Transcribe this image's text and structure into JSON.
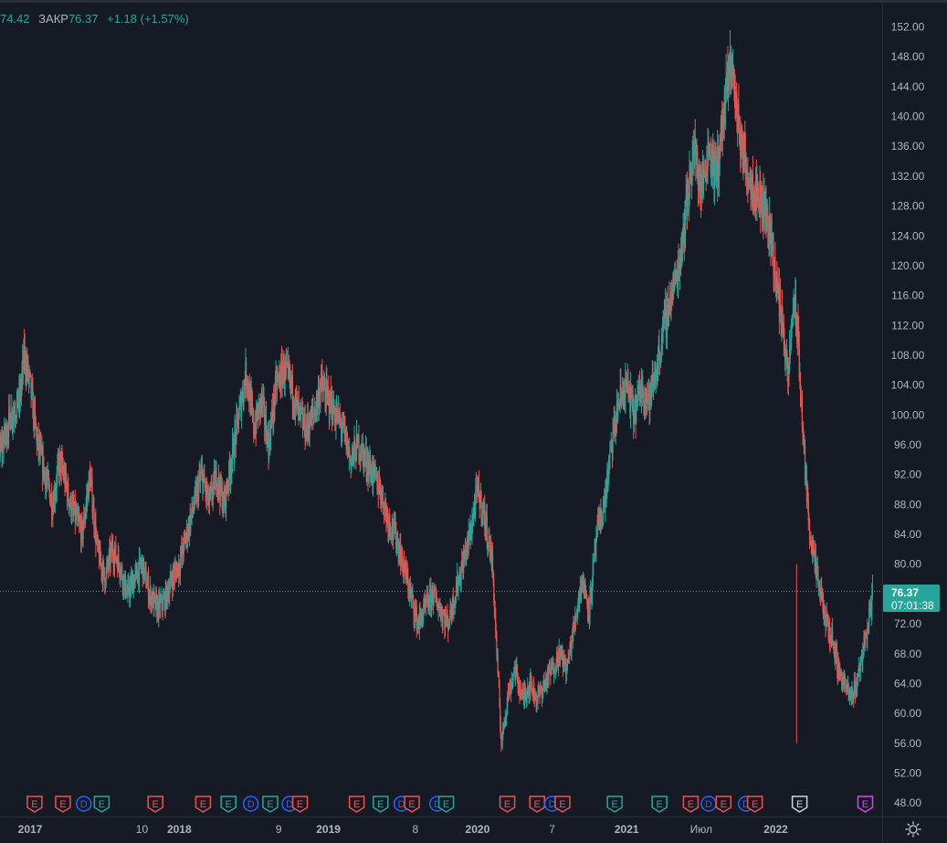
{
  "legend": {
    "prev_value": "74.42",
    "close_label": "ЗАКР",
    "close_value": "76.37",
    "change": "+1.18 (+1.57%)"
  },
  "price_badge": {
    "price": "76.37",
    "countdown": "07:01:38"
  },
  "colors": {
    "background": "#161a25",
    "up": "#26a69a",
    "down": "#ef5350",
    "axis_text": "#b2b5be",
    "axis_line": "#2a2e39"
  },
  "chart_data": {
    "type": "candlestick",
    "y_ticks": [
      "48.00",
      "52.00",
      "56.00",
      "60.00",
      "64.00",
      "68.00",
      "72.00",
      "80.00",
      "84.00",
      "88.00",
      "92.00",
      "96.00",
      "100.00",
      "104.00",
      "108.00",
      "112.00",
      "116.00",
      "120.00",
      "124.00",
      "128.00",
      "132.00",
      "136.00",
      "140.00",
      "144.00",
      "148.00",
      "152.00"
    ],
    "x_ticks": [
      {
        "label": "2017",
        "bold": true,
        "t": 2017.0
      },
      {
        "label": "10",
        "bold": false,
        "t": 2017.75
      },
      {
        "label": "2018",
        "bold": true,
        "t": 2018.0
      },
      {
        "label": "9",
        "bold": false,
        "t": 2018.667
      },
      {
        "label": "2019",
        "bold": true,
        "t": 2019.0
      },
      {
        "label": "8",
        "bold": false,
        "t": 2019.583
      },
      {
        "label": "2020",
        "bold": true,
        "t": 2020.0
      },
      {
        "label": "7",
        "bold": false,
        "t": 2020.5
      },
      {
        "label": "2021",
        "bold": true,
        "t": 2021.0
      },
      {
        "label": "Июл",
        "bold": false,
        "t": 2021.5
      },
      {
        "label": "2022",
        "bold": true,
        "t": 2022.0
      }
    ],
    "ylim": [
      48,
      152
    ],
    "last_price": 76.37,
    "price_path": [
      [
        2016.6,
        85
      ],
      [
        2016.65,
        80
      ],
      [
        2016.72,
        92
      ],
      [
        2016.8,
        95
      ],
      [
        2016.87,
        100
      ],
      [
        2016.93,
        102
      ],
      [
        2016.96,
        108
      ],
      [
        2017.0,
        104
      ],
      [
        2017.05,
        96
      ],
      [
        2017.1,
        92
      ],
      [
        2017.15,
        88
      ],
      [
        2017.2,
        94
      ],
      [
        2017.27,
        88
      ],
      [
        2017.35,
        84
      ],
      [
        2017.4,
        92
      ],
      [
        2017.45,
        82
      ],
      [
        2017.5,
        78
      ],
      [
        2017.55,
        82
      ],
      [
        2017.6,
        80
      ],
      [
        2017.65,
        76
      ],
      [
        2017.7,
        78
      ],
      [
        2017.75,
        80
      ],
      [
        2017.8,
        76
      ],
      [
        2017.85,
        74
      ],
      [
        2017.9,
        75
      ],
      [
        2017.95,
        78
      ],
      [
        2018.0,
        80
      ],
      [
        2018.05,
        84
      ],
      [
        2018.1,
        88
      ],
      [
        2018.15,
        92
      ],
      [
        2018.2,
        88
      ],
      [
        2018.25,
        92
      ],
      [
        2018.3,
        88
      ],
      [
        2018.35,
        94
      ],
      [
        2018.4,
        100
      ],
      [
        2018.45,
        106
      ],
      [
        2018.5,
        98
      ],
      [
        2018.55,
        102
      ],
      [
        2018.6,
        96
      ],
      [
        2018.65,
        104
      ],
      [
        2018.7,
        106
      ],
      [
        2018.75,
        104
      ],
      [
        2018.8,
        100
      ],
      [
        2018.85,
        98
      ],
      [
        2018.9,
        100
      ],
      [
        2018.95,
        104
      ],
      [
        2019.0,
        102
      ],
      [
        2019.05,
        100
      ],
      [
        2019.1,
        98
      ],
      [
        2019.15,
        94
      ],
      [
        2019.2,
        96
      ],
      [
        2019.25,
        94
      ],
      [
        2019.3,
        92
      ],
      [
        2019.35,
        90
      ],
      [
        2019.4,
        86
      ],
      [
        2019.45,
        84
      ],
      [
        2019.5,
        80
      ],
      [
        2019.55,
        76
      ],
      [
        2019.6,
        72
      ],
      [
        2019.65,
        74
      ],
      [
        2019.7,
        76
      ],
      [
        2019.75,
        74
      ],
      [
        2019.8,
        72
      ],
      [
        2019.85,
        76
      ],
      [
        2019.9,
        80
      ],
      [
        2019.95,
        84
      ],
      [
        2020.0,
        90
      ],
      [
        2020.05,
        86
      ],
      [
        2020.1,
        80
      ],
      [
        2020.13,
        68
      ],
      [
        2020.16,
        56
      ],
      [
        2020.2,
        62
      ],
      [
        2020.25,
        66
      ],
      [
        2020.3,
        62
      ],
      [
        2020.35,
        64
      ],
      [
        2020.4,
        62
      ],
      [
        2020.45,
        64
      ],
      [
        2020.5,
        66
      ],
      [
        2020.55,
        68
      ],
      [
        2020.6,
        66
      ],
      [
        2020.65,
        72
      ],
      [
        2020.7,
        78
      ],
      [
        2020.75,
        74
      ],
      [
        2020.8,
        84
      ],
      [
        2020.85,
        88
      ],
      [
        2020.9,
        96
      ],
      [
        2020.95,
        102
      ],
      [
        2021.0,
        104
      ],
      [
        2021.05,
        100
      ],
      [
        2021.1,
        104
      ],
      [
        2021.15,
        102
      ],
      [
        2021.2,
        106
      ],
      [
        2021.25,
        112
      ],
      [
        2021.3,
        116
      ],
      [
        2021.35,
        120
      ],
      [
        2021.4,
        128
      ],
      [
        2021.45,
        136
      ],
      [
        2021.5,
        130
      ],
      [
        2021.55,
        136
      ],
      [
        2021.6,
        132
      ],
      [
        2021.65,
        140
      ],
      [
        2021.7,
        148
      ],
      [
        2021.73,
        142
      ],
      [
        2021.77,
        136
      ],
      [
        2021.82,
        132
      ],
      [
        2021.87,
        130
      ],
      [
        2021.92,
        128
      ],
      [
        2021.97,
        124
      ],
      [
        2022.0,
        118
      ],
      [
        2022.05,
        112
      ],
      [
        2022.08,
        104
      ],
      [
        2022.12,
        116
      ],
      [
        2022.15,
        110
      ],
      [
        2022.18,
        98
      ],
      [
        2022.22,
        86
      ],
      [
        2022.26,
        80
      ],
      [
        2022.3,
        76
      ],
      [
        2022.34,
        72
      ],
      [
        2022.38,
        70
      ],
      [
        2022.42,
        66
      ],
      [
        2022.46,
        64
      ],
      [
        2022.5,
        62
      ],
      [
        2022.54,
        64
      ],
      [
        2022.58,
        68
      ],
      [
        2022.62,
        72
      ],
      [
        2022.65,
        76.37
      ]
    ],
    "event_markers": [
      {
        "t": 2016.64,
        "letter": "E",
        "color": "#26a69a"
      },
      {
        "t": 2017.03,
        "letter": "E",
        "color": "#ef5350"
      },
      {
        "t": 2017.22,
        "letter": "E",
        "color": "#ef5350"
      },
      {
        "t": 2017.36,
        "letter": "D",
        "color": "#2962ff"
      },
      {
        "t": 2017.48,
        "letter": "E",
        "color": "#26a69a"
      },
      {
        "t": 2017.84,
        "letter": "E",
        "color": "#ef5350"
      },
      {
        "t": 2018.16,
        "letter": "E",
        "color": "#ef5350"
      },
      {
        "t": 2018.33,
        "letter": "E",
        "color": "#26a69a"
      },
      {
        "t": 2018.48,
        "letter": "D",
        "color": "#2962ff"
      },
      {
        "t": 2018.61,
        "letter": "E",
        "color": "#26a69a"
      },
      {
        "t": 2018.74,
        "letter": "D",
        "color": "#2962ff"
      },
      {
        "t": 2018.81,
        "letter": "E",
        "color": "#ef5350"
      },
      {
        "t": 2019.19,
        "letter": "E",
        "color": "#ef5350"
      },
      {
        "t": 2019.35,
        "letter": "E",
        "color": "#26a69a"
      },
      {
        "t": 2019.49,
        "letter": "D",
        "color": "#2962ff"
      },
      {
        "t": 2019.56,
        "letter": "E",
        "color": "#ef5350"
      },
      {
        "t": 2019.73,
        "letter": "D",
        "color": "#2962ff"
      },
      {
        "t": 2019.79,
        "letter": "E",
        "color": "#26a69a"
      },
      {
        "t": 2020.2,
        "letter": "E",
        "color": "#ef5350"
      },
      {
        "t": 2020.4,
        "letter": "E",
        "color": "#ef5350"
      },
      {
        "t": 2020.5,
        "letter": "D",
        "color": "#2962ff"
      },
      {
        "t": 2020.57,
        "letter": "E",
        "color": "#ef5350"
      },
      {
        "t": 2020.92,
        "letter": "E",
        "color": "#26a69a"
      },
      {
        "t": 2021.22,
        "letter": "E",
        "color": "#26a69a"
      },
      {
        "t": 2021.43,
        "letter": "E",
        "color": "#ef5350"
      },
      {
        "t": 2021.55,
        "letter": "D",
        "color": "#2962ff"
      },
      {
        "t": 2021.65,
        "letter": "E",
        "color": "#ef5350"
      },
      {
        "t": 2021.8,
        "letter": "D",
        "color": "#2962ff"
      },
      {
        "t": 2021.86,
        "letter": "E",
        "color": "#ef5350"
      },
      {
        "t": 2022.16,
        "letter": "E",
        "color": "#d1d4dc"
      },
      {
        "t": 2022.6,
        "letter": "E",
        "color": "#e040fb"
      }
    ]
  }
}
